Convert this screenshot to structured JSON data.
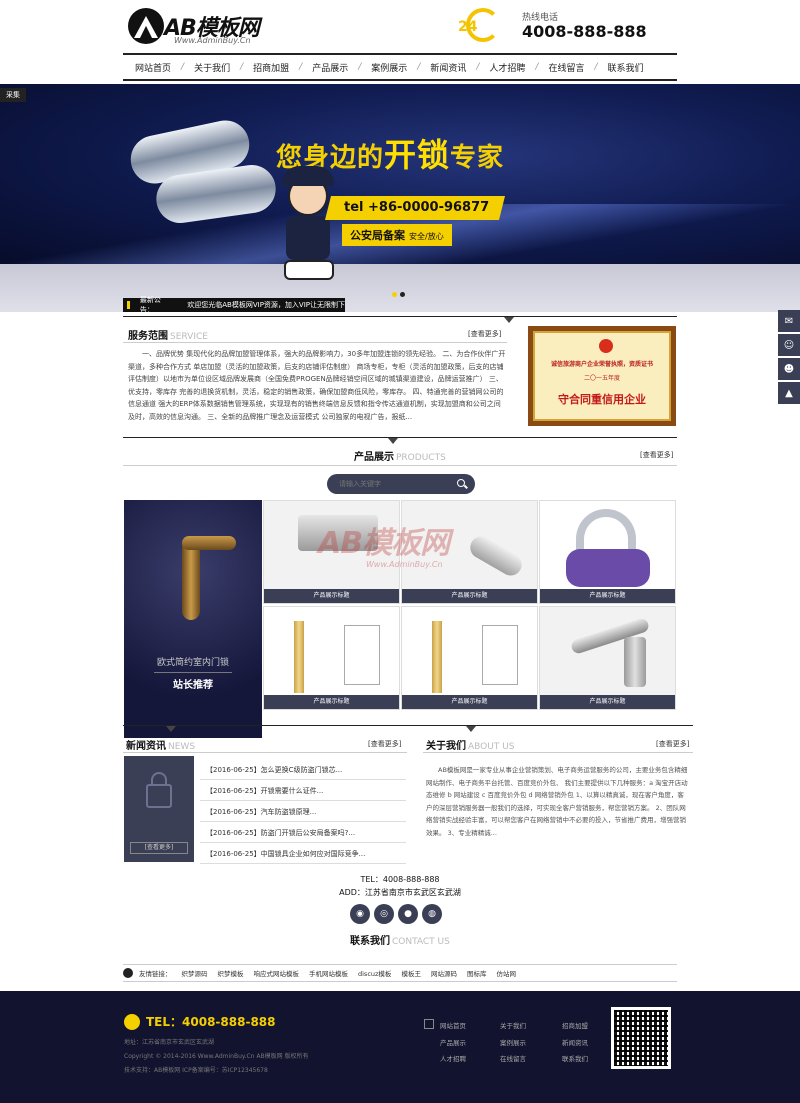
{
  "header": {
    "logo_name": "AB模板网",
    "logo_url": "Www.AdminBuy.Cn",
    "hotline_badge": "24",
    "hotline_label": "热线电话",
    "hotline_number": "4008-888-888"
  },
  "nav": {
    "items": [
      "网站首页",
      "关于我们",
      "招商加盟",
      "产品展示",
      "案例展示",
      "新闻资讯",
      "人才招聘",
      "在线留言",
      "联系我们"
    ]
  },
  "banner": {
    "tag": "采集",
    "headline_a": "您身边的",
    "headline_b": "开锁",
    "headline_c": "专家",
    "tel": "tel +86-0000-96877",
    "police_text": "公安局备案",
    "police_sub": "安全/放心",
    "accent": "#f5d000"
  },
  "notice": {
    "label": "最新公告：",
    "text": "欢迎您光临AB模板网VIP资源，加入VIP让无限制下"
  },
  "service": {
    "title": "服务范围",
    "title_en": "SERVICE",
    "more": "[查看更多]",
    "text": "一、品牌优势 集现代化的品牌加盟管理体系，强大的品牌影响力，30多年加盟连锁的领先经验。 二、为合作伙伴广开渠道，多种合作方式 单店加盟（灵活的加盟政策，后支的店铺评估制度） 商场专柜，专柜（灵活的加盟政策，后支的店铺评估制度）以地市为单位设区域品牌发展商（全国免费PROGEN品牌经销空间区域的城镇渠道建设，品牌运营推广） 三、优支持，零库存 完善的退换货机制，灵活，稳定的销售政策，确保加盟商低风险，零库存。 四、特通完善的营销网公司的信息通道 强大的ERP体系数据销售管理系统，实现现有的销售终端信息反馈和指令传达通道机制，实现加盟商和公司之间及时，高效的信息沟通。 三、全新的品牌推广理念及运营模式 公司独家的电视广告，报纸...",
    "cert_line1": "诚信旅游商户企业荣誉执照，资质证书",
    "cert_line2": "二〇一五年度",
    "cert_line3": "守合同重信用企业"
  },
  "products": {
    "title": "产品展示",
    "title_en": "PRODUCTS",
    "more": "[查看更多]",
    "search_placeholder": "请输入关键字",
    "featured_caption": "欧式简约室内门锁",
    "featured_sub": "站长推荐",
    "items": [
      "产品展示标题",
      "产品展示标题",
      "产品展示标题",
      "产品展示标题",
      "产品展示标题",
      "产品展示标题"
    ],
    "watermark": "AB模板网",
    "watermark_url": "Www.AdminBuy.Cn"
  },
  "news": {
    "title": "新闻资讯",
    "title_en": "NEWS",
    "more": "[查看更多]",
    "panel_button": "[查看更多]",
    "items": [
      "【2016-06-25】怎么更换C级防盗门锁芯...",
      "【2016-06-25】开锁需要什么证件...",
      "【2016-06-25】汽车防盗锁原理...",
      "【2016-06-25】防盗门开锁后公安局备案吗?...",
      "【2016-06-25】中国锁具企业如何应对国际竞争..."
    ]
  },
  "about": {
    "title": "关于我们",
    "title_en": "ABOUT US",
    "more": "[查看更多]",
    "text": "AB模板网是一家专业从事企业营销策划、电子商务运营服务的公司，主要业务包含精细网站制作、电子商务平台托管、百度竞价外包、 我们主要提供以下几种服务：a 淘宝开店动态维修 b 网站建设 c 百度竞价外包 d 网络营销外包 1、以算以精真诚，现在客户角度，客户的深层营销服务器一般我们的选择，可实现全客户营销服务，帮您营销方案。 2、团队网络营销实战经验丰富，可以帮您客户在网络营销中不必要的投入，节省推广费用，增强营销效果。 3、专业精精诚..."
  },
  "contact": {
    "tel": "TEL：4008-888-888",
    "addr": "ADD：江苏省南京市玄武区玄武湖",
    "title": "联系我们",
    "title_en": "CONTACT US"
  },
  "links": {
    "label": "友情链接：",
    "items": [
      "织梦源码",
      "织梦模板",
      "响应式网站模板",
      "手机网站模板",
      "discuz模板",
      "模板王",
      "网站源码",
      "图标库",
      "仿站网"
    ]
  },
  "footer": {
    "tel": "TEL：4008-888-888",
    "addr": "地址：江苏省南京市玄武区玄武湖",
    "copyright": "Copyright © 2014-2016 Www.AdminBuy.Cn AB模板网 版权所有",
    "support": "技术支持：AB模板网     ICP备案编号：苏ICP12345678",
    "col1": [
      "网站首页",
      "产品展示",
      "人才招聘"
    ],
    "col2": [
      "关于我们",
      "案例展示",
      "在线留言"
    ],
    "col3": [
      "招商加盟",
      "新闻资讯",
      "联系我们"
    ]
  }
}
